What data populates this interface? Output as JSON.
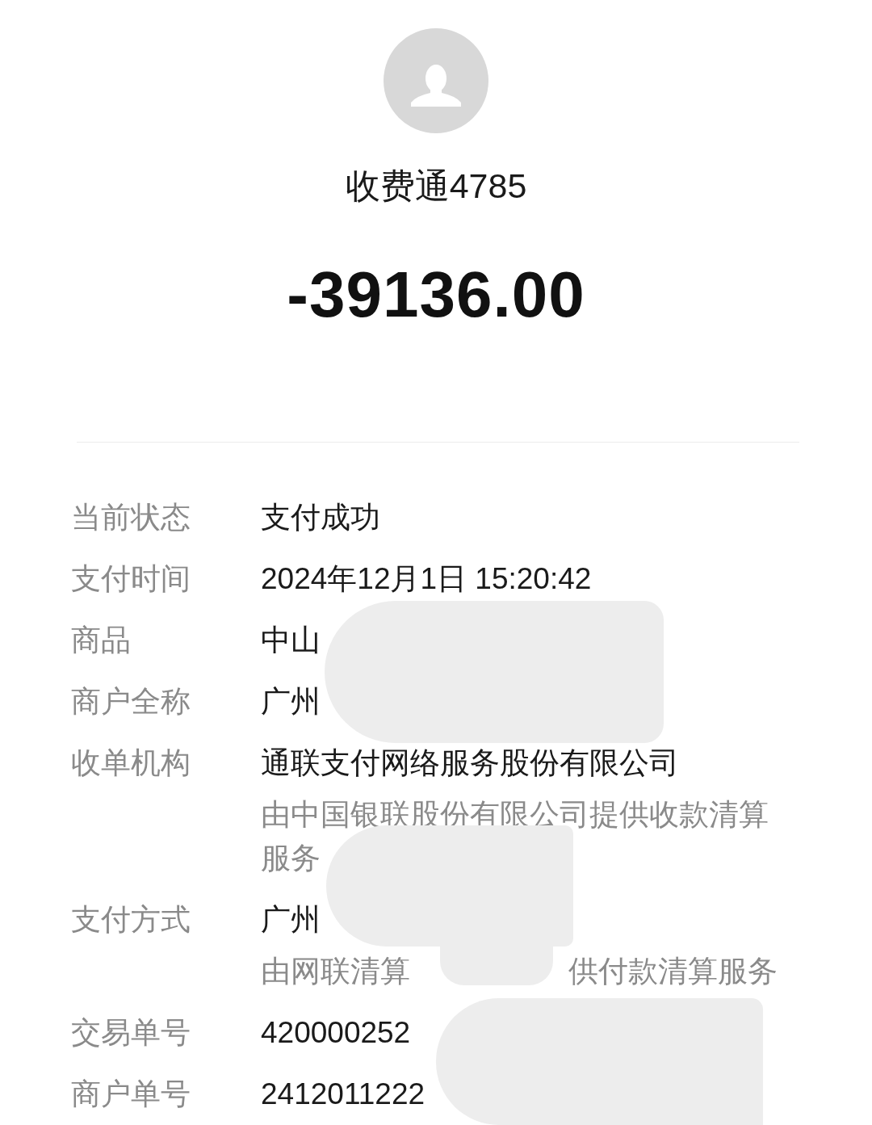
{
  "payee": {
    "name": "收费通4785"
  },
  "amount": "-39136.00",
  "details": [
    {
      "label": "当前状态",
      "value": "支付成功"
    },
    {
      "label": "支付时间",
      "value": "2024年12月1日 15:20:42"
    },
    {
      "label": "商品",
      "value": "中山"
    },
    {
      "label": "商户全称",
      "value": "广州"
    },
    {
      "label": "收单机构",
      "value": "通联支付网络服务股份有限公司",
      "note": "由中国银联股份有限公司提供收款清算服务"
    },
    {
      "label": "支付方式",
      "value": "广州",
      "note_fragments": [
        "由网联清算",
        "供付款清算服务"
      ]
    },
    {
      "label": "交易单号",
      "value": "420000252"
    },
    {
      "label": "商户单号",
      "value": "2412011222"
    }
  ]
}
